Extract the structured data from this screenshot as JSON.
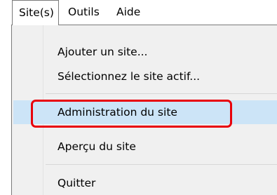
{
  "menubar": {
    "items": [
      {
        "label": "Site(s)"
      },
      {
        "label": "Outils"
      },
      {
        "label": "Aide"
      }
    ]
  },
  "dropdown": {
    "items": [
      {
        "label": "Ajouter un site..."
      },
      {
        "label": "Sélectionnez le site actif..."
      },
      {
        "label": "Administration du site"
      },
      {
        "label": "Aperçu du site"
      },
      {
        "label": "Quitter"
      }
    ],
    "selected_item": "Administration du site"
  },
  "colors": {
    "selection": "#cce4f7",
    "highlight_annotation": "#e8000b",
    "menu_background": "#f0f0f0"
  }
}
